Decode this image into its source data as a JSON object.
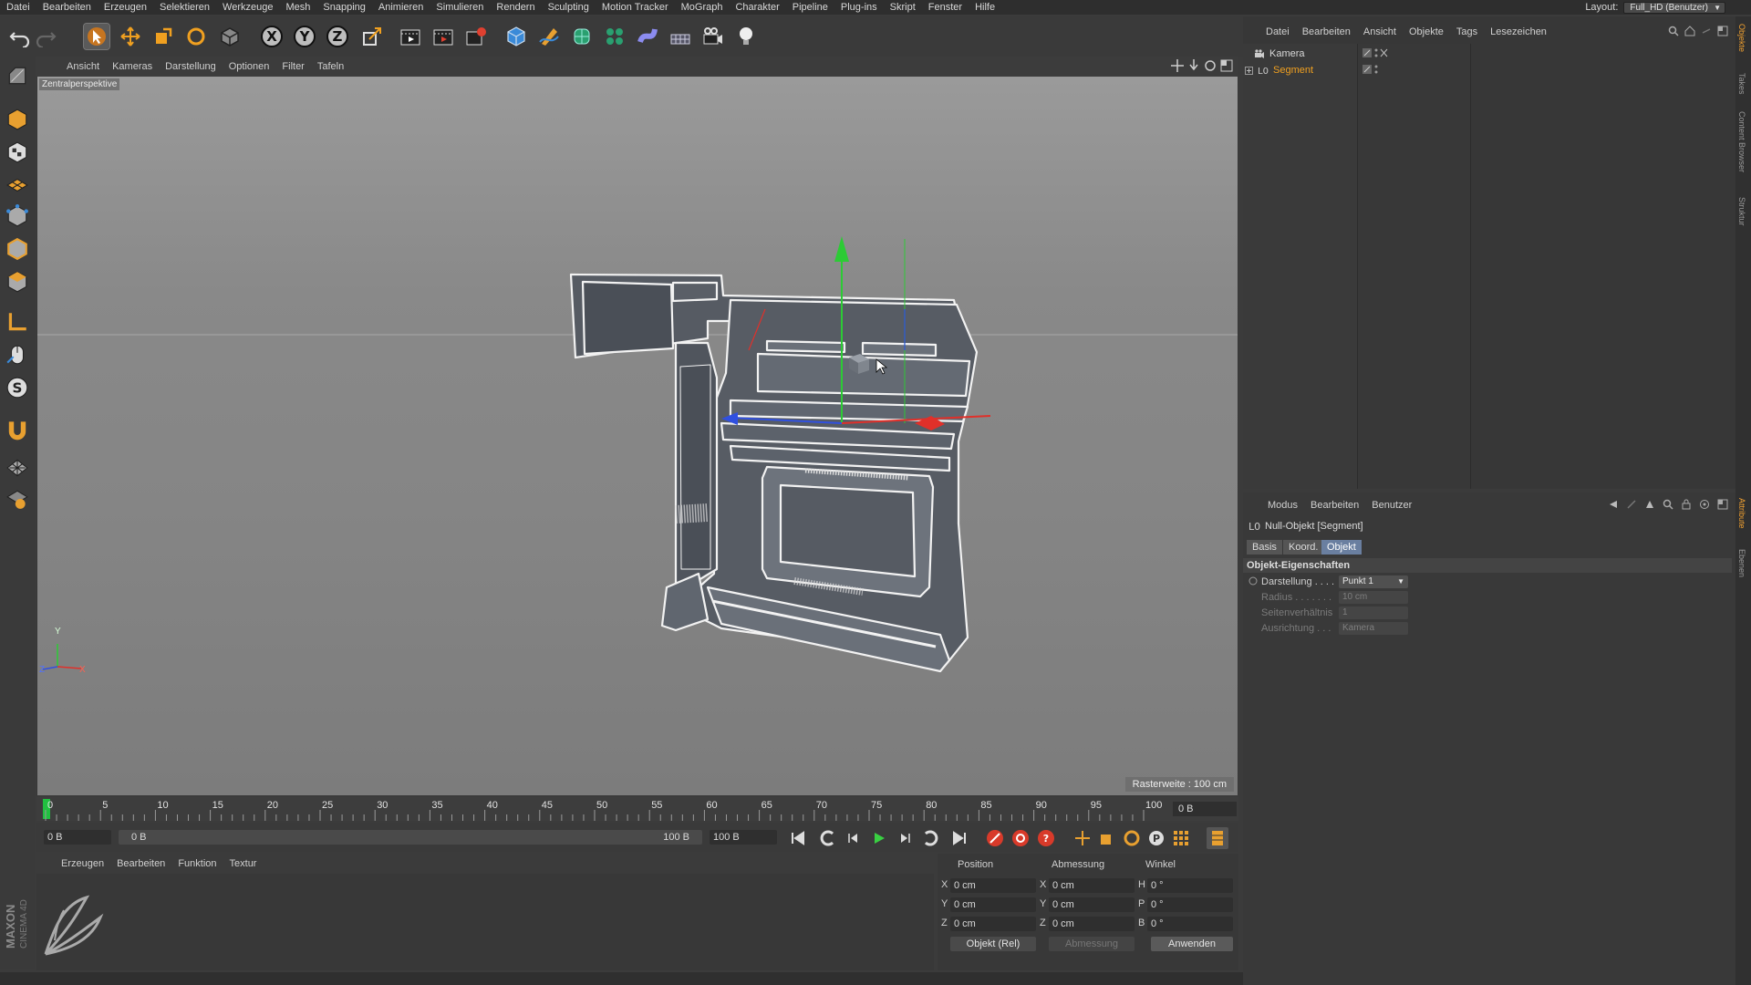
{
  "menubar": {
    "items": [
      "Datei",
      "Bearbeiten",
      "Erzeugen",
      "Selektieren",
      "Werkzeuge",
      "Mesh",
      "Snapping",
      "Animieren",
      "Simulieren",
      "Rendern",
      "Sculpting",
      "Motion Tracker",
      "MoGraph",
      "Charakter",
      "Pipeline",
      "Plug-ins",
      "Skript",
      "Fenster",
      "Hilfe"
    ],
    "layout_label": "Layout:",
    "layout_value": "Full_HD (Benutzer)"
  },
  "toolbar": {
    "icons": [
      "undo-icon",
      "redo-icon",
      "select-live-icon",
      "move-icon",
      "scale-icon",
      "rotate-icon",
      "object-icon",
      "x-axis-icon",
      "y-axis-icon",
      "z-axis-icon",
      "world-coords-icon",
      "render-view-icon",
      "render-picture-viewer-icon",
      "render-settings-icon",
      "cube-icon",
      "pen-icon",
      "subdivision-icon",
      "cloner-icon",
      "deformer-icon",
      "floor-icon",
      "camera-icon",
      "light-icon"
    ],
    "x_label": "X",
    "y_label": "Y",
    "z_label": "Z"
  },
  "viewport": {
    "menu": [
      "Ansicht",
      "Kameras",
      "Darstellung",
      "Optionen",
      "Filter",
      "Tafeln"
    ],
    "camera_label": "Zentralperspektive",
    "grid_info": "Rasterweite : 100 cm",
    "axis_y": "Y",
    "axis_z": "Z",
    "axis_x": "X"
  },
  "timeline": {
    "ticks": [
      "0",
      "5",
      "10",
      "15",
      "20",
      "25",
      "30",
      "35",
      "40",
      "45",
      "50",
      "55",
      "60",
      "65",
      "70",
      "75",
      "80",
      "85",
      "90",
      "95",
      "100"
    ],
    "current_frame_field": "0 B",
    "current_frame": 0,
    "max_frame": 100
  },
  "playback": {
    "start_field": "0 B",
    "range_start": "0 B",
    "range_end": "100 B",
    "end_field": "100 B"
  },
  "material_manager": {
    "menu": [
      "Erzeugen",
      "Bearbeiten",
      "Funktion",
      "Textur"
    ]
  },
  "coordinates": {
    "headers": [
      "Position",
      "Abmessung",
      "Winkel"
    ],
    "rows": [
      {
        "axis": "X",
        "pos": "0 cm",
        "size_axis": "X",
        "size": "0 cm",
        "angle_axis": "H",
        "angle": "0 °"
      },
      {
        "axis": "Y",
        "pos": "0 cm",
        "size_axis": "Y",
        "size": "0 cm",
        "angle_axis": "P",
        "angle": "0 °"
      },
      {
        "axis": "Z",
        "pos": "0 cm",
        "size_axis": "Z",
        "size": "0 cm",
        "angle_axis": "B",
        "angle": "0 °"
      }
    ],
    "mode_select": "Objekt (Rel)",
    "size_select": "Abmessung",
    "apply_button": "Anwenden"
  },
  "object_manager": {
    "menu": [
      "Datei",
      "Bearbeiten",
      "Ansicht",
      "Objekte",
      "Tags",
      "Lesezeichen"
    ],
    "objects": [
      {
        "name": "Kamera",
        "color": "#d8d8d8"
      },
      {
        "name": "Segment",
        "color": "#f0a020"
      }
    ]
  },
  "attribute_manager": {
    "menu": [
      "Modus",
      "Bearbeiten",
      "Benutzer"
    ],
    "object_title": "Null-Objekt [Segment]",
    "tabs": [
      "Basis",
      "Koord.",
      "Objekt"
    ],
    "active_tab": "Objekt",
    "section": "Objekt-Eigenschaften",
    "props": [
      {
        "label": "Darstellung . . . .",
        "value": "Punkt 1",
        "enabled": true
      },
      {
        "label": "Radius . . . . . . .",
        "value": "10 cm",
        "enabled": false
      },
      {
        "label": "Seitenverhältnis",
        "value": "1",
        "enabled": false
      },
      {
        "label": "Ausrichtung . . .",
        "value": "Kamera",
        "enabled": false
      }
    ]
  },
  "side_tabs": [
    "Objekte",
    "Takes",
    "Content Browser",
    "Struktur",
    "Attribute",
    "Ebenen"
  ],
  "branding": {
    "vendor": "MAXON",
    "product": "CINEMA 4D"
  },
  "colors": {
    "accent_orange": "#f0a020",
    "axis_x": "#e0302a",
    "axis_y": "#38c038",
    "axis_z": "#3050e0",
    "playhead": "#20c040"
  }
}
